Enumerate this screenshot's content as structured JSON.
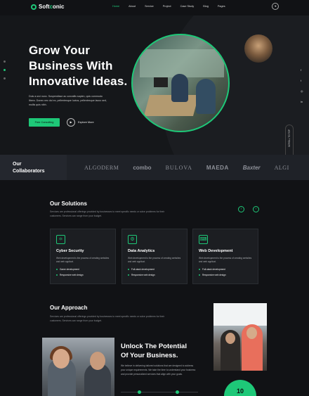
{
  "brand": {
    "prefix": "Soft",
    "accent": "c",
    "suffix": "onic",
    "accent_color": "#1ec878"
  },
  "nav": {
    "items": [
      "Home",
      "About",
      "Service",
      "Project",
      "Case Study",
      "Blog",
      "Pages"
    ],
    "active_index": 0,
    "action_icon": "arrow-icon"
  },
  "hero": {
    "title_lines": [
      "Grow Your",
      "Business With",
      "Innovative Ideas."
    ],
    "description": "Duis a orci nunc. Suspendisse ac convallis sapien, quis commodo libero. Donec nec dui ex, pellentesque luctus, pellentesque lacus sed, mollis quis nibh.",
    "primary_button": "Free Consulting",
    "secondary_button": "Explore More",
    "scroll_label": "SCROLL TO TOP",
    "social_icons": [
      "facebook-icon",
      "twitter-icon",
      "instagram-icon",
      "linkedin-icon"
    ]
  },
  "collaborators": {
    "title_line1": "Our",
    "title_line2": "Collaborators",
    "logos": [
      "ALGODERM",
      "combo",
      "BULOVA",
      "MAEDA",
      "Baxter",
      "ALGI"
    ]
  },
  "solutions": {
    "title": "Our Solutions",
    "description": "Services are professional offerings provided by businesses to meet specific needs or solve problems for their customers. Services can range from your budget.",
    "cards": [
      {
        "icon": "atom-icon",
        "title": "Cyber Security",
        "description": "Web development is the process of creating websites and web applicat.",
        "bullets": [
          "Game development",
          "Responsive web design"
        ]
      },
      {
        "icon": "analytics-icon",
        "title": "Data Analytics",
        "description": "Web development is the process of creating websites and web applicat.",
        "bullets": [
          "Full-stack development",
          "Responsive web design"
        ]
      },
      {
        "icon": "code-icon",
        "title": "Web Development",
        "description": "Web development is the process of creating websites and web applicat.",
        "bullets": [
          "Full-stack development",
          "Responsive web design"
        ]
      }
    ]
  },
  "approach": {
    "title": "Our Approach",
    "description": "Services are professional offerings provided by businesses to meet specific needs or solve problems for their customers. Services can range from your budget.",
    "unlock_line1": "Unlock The Potential",
    "unlock_line2": "Of Your Business.",
    "unlock_description": "We believe in delivering tailored solutions that are designed to address your unique requirements. We take the time to understand your business and provide personalized services that align with your goals.",
    "badge_number": "10"
  }
}
